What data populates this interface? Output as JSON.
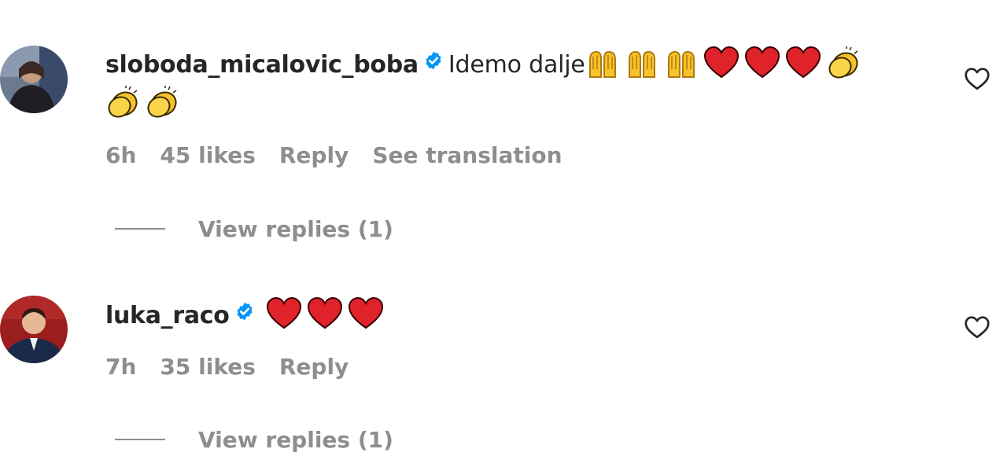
{
  "comments": [
    {
      "username": "sloboda_micalovic_boba",
      "verified": true,
      "text": "Idemo dalje",
      "emojis": [
        "raising-hands",
        "raising-hands",
        "raising-hands",
        "red-heart",
        "red-heart",
        "red-heart",
        "clapping-hands",
        "clapping-hands",
        "clapping-hands"
      ],
      "time": "6h",
      "likes": "45 likes",
      "reply_label": "Reply",
      "translation_label": "See translation",
      "view_replies": "View replies (1)"
    },
    {
      "username": "luka_raco",
      "verified": true,
      "text": "",
      "emojis": [
        "red-heart",
        "red-heart",
        "red-heart"
      ],
      "time": "7h",
      "likes": "35 likes",
      "reply_label": "Reply",
      "view_replies": "View replies (1)"
    }
  ],
  "colors": {
    "text": "#262626",
    "muted": "#8e8e8e",
    "verified": "#0095f6",
    "heart": "#e0222b"
  }
}
